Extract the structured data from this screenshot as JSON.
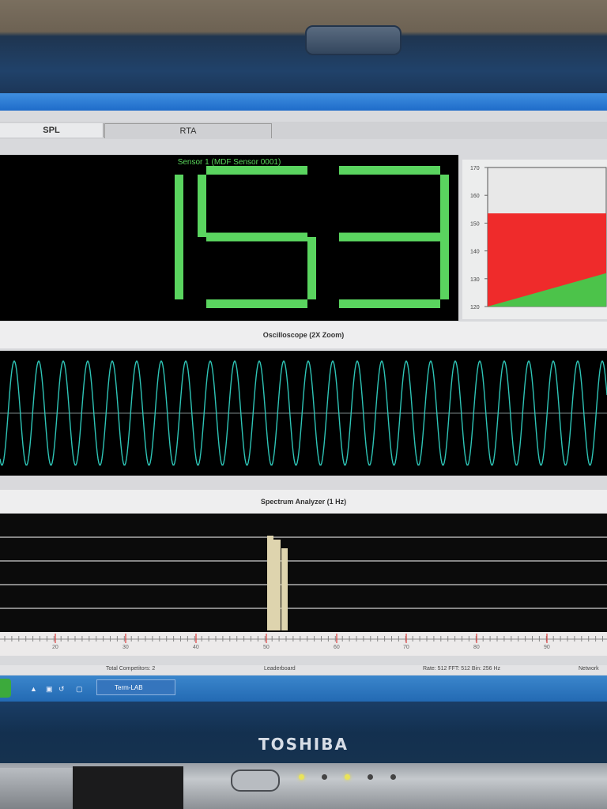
{
  "tabs": [
    {
      "label": "SPL",
      "active": true
    },
    {
      "label": "RTA",
      "active": false
    }
  ],
  "spl": {
    "sensor_label": "Sensor 1 (MDF  Sensor 0001)",
    "value": "153.5",
    "digit_color": "#5ad45f"
  },
  "level_chart": {
    "ticks": [
      "170",
      "160",
      "150",
      "140",
      "130",
      "120"
    ],
    "ylim": [
      120,
      170
    ],
    "level": 153.5,
    "colors": {
      "top": "#e8e8e8",
      "level": "#ef2b2b",
      "ramp": "#4cc34a"
    }
  },
  "oscilloscope": {
    "title": "Oscilloscope (2X Zoom)",
    "trace_color": "#2ec4b6"
  },
  "spectrum": {
    "title": "Spectrum Analyzer (1 Hz)",
    "bar_color": "#ded4ae",
    "axis_labels": [
      "20",
      "30",
      "40",
      "50",
      "60",
      "70",
      "80",
      "90"
    ]
  },
  "status_bar": {
    "competitors": "Total Competitors: 2",
    "leaderboard": "Leaderboard",
    "rate": "Rate: 512  FFT: 512  Bin: 256 Hz",
    "network": "Network"
  },
  "taskbar": {
    "app_button": "Term-LAB"
  },
  "brand": "TOSHIBA"
}
